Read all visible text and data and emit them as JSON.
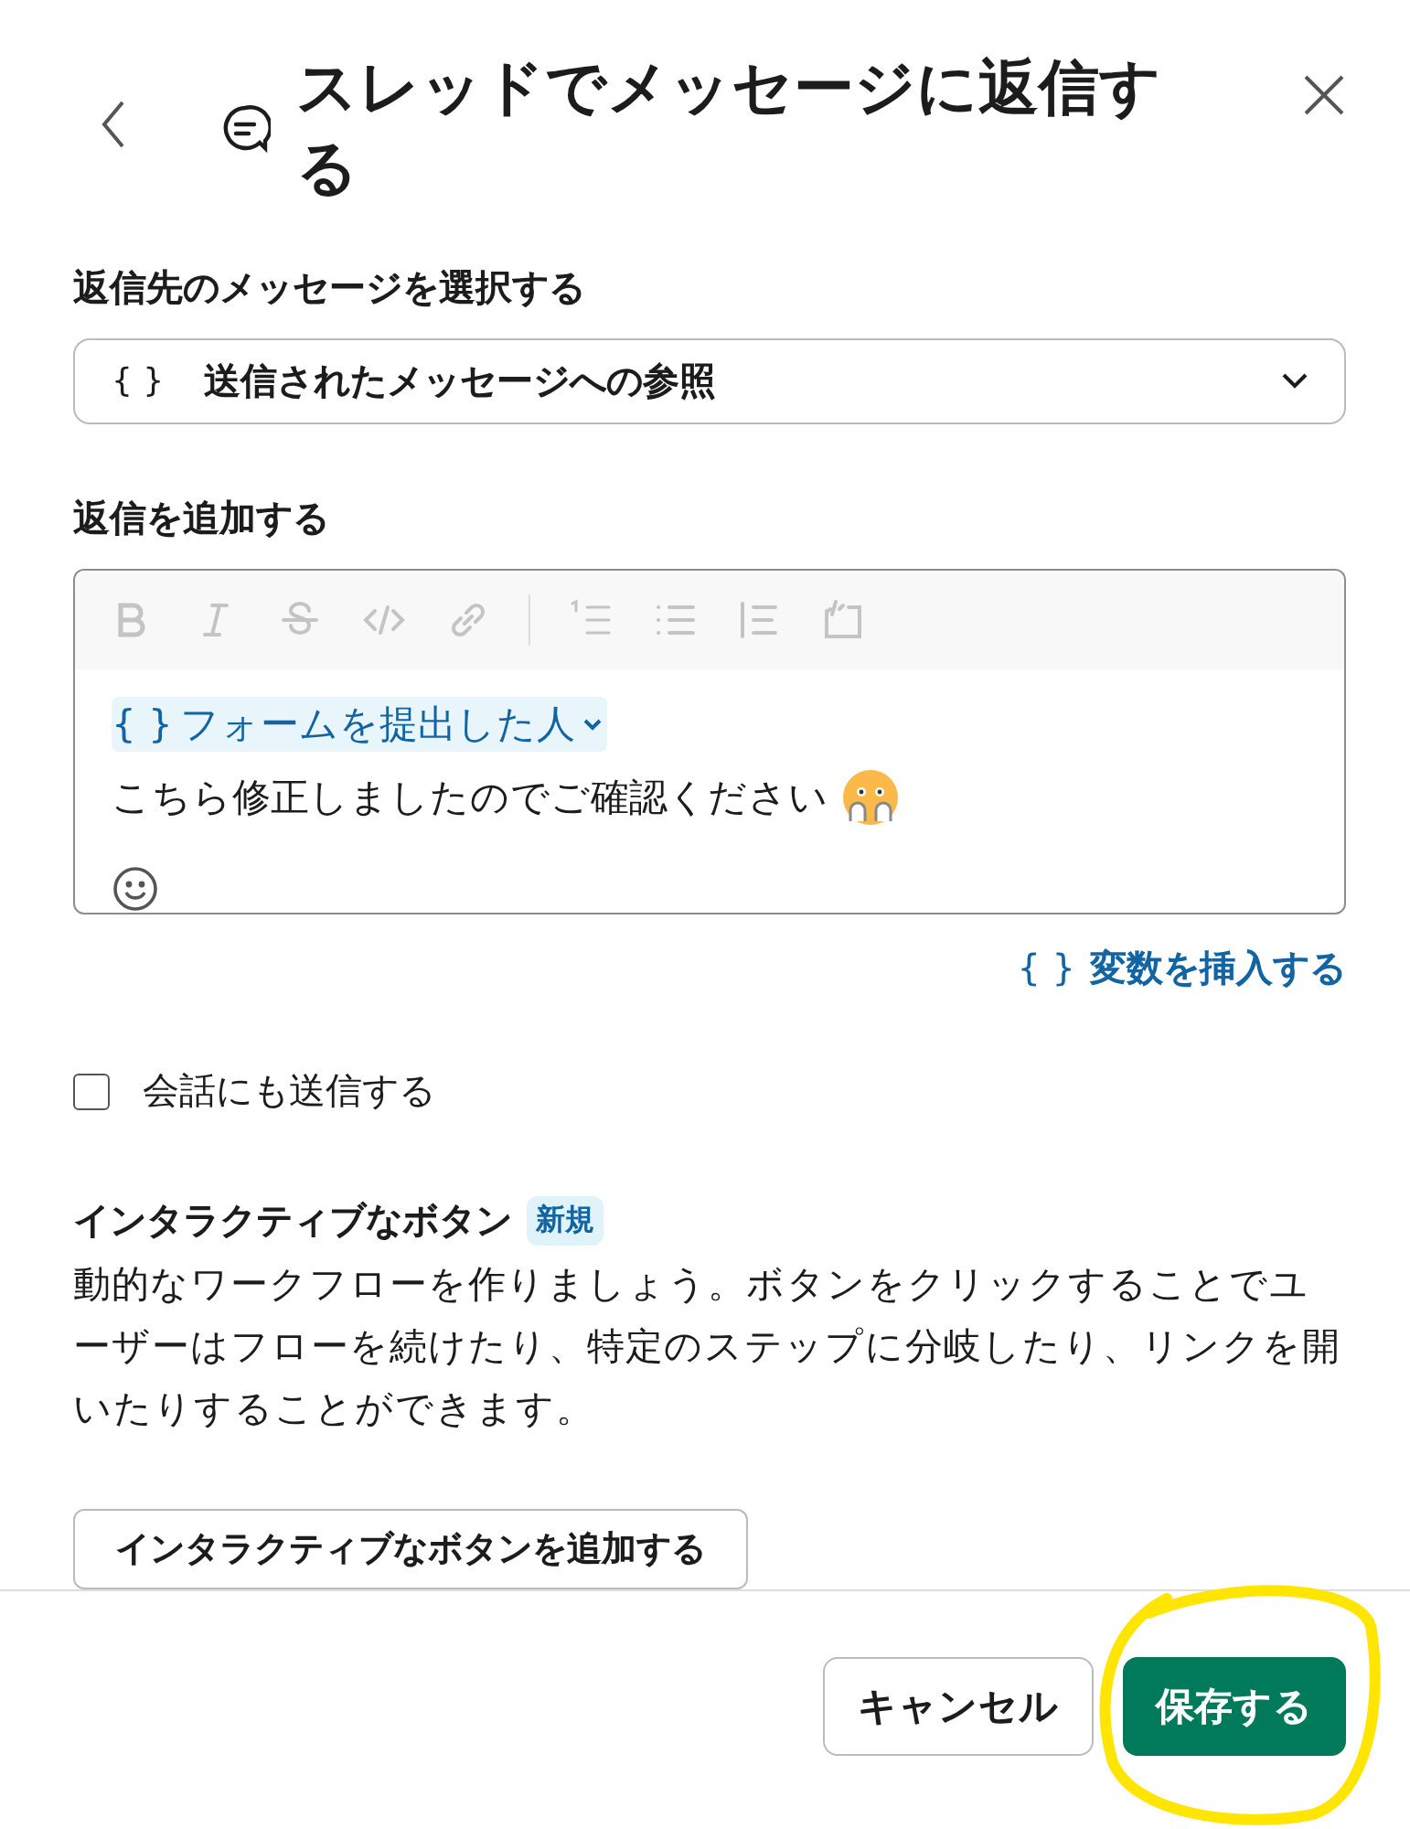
{
  "header": {
    "title": "スレッドでメッセージに返信する"
  },
  "reply_target": {
    "label": "返信先のメッセージを選択する",
    "brace": "{ }",
    "value": "送信されたメッセージへの参照"
  },
  "reply": {
    "label": "返信を追加する",
    "variable_chip": {
      "brace": "{ }",
      "text": "フォームを提出した人"
    },
    "message": "こちら修正しましたのでご確認ください"
  },
  "insert_variable": {
    "brace": "{ }",
    "text": "変数を挿入する"
  },
  "also_send": {
    "label": "会話にも送信する",
    "checked": false
  },
  "interactive": {
    "title": "インタラクティブなボタン",
    "badge": "新規",
    "description": "動的なワークフローを作りましょう。ボタンをクリックすることでユーザーはフローを続けたり、特定のステップに分岐したり、リンクを開いたりすることができます。",
    "button": "インタラクティブなボタンを追加する"
  },
  "footer": {
    "buttons": [
      {
        "label": "キャンセル",
        "kind": "secondary"
      },
      {
        "label": "保存する",
        "kind": "primary"
      }
    ]
  }
}
